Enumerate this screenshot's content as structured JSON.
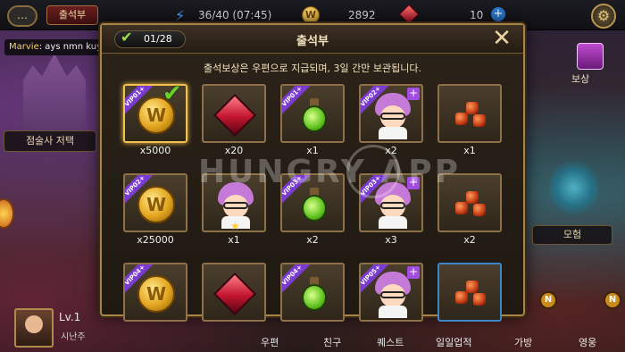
{
  "topbar": {
    "chat_icon": "…",
    "tab_label": "출석부",
    "stamina": "36/40 (07:45)",
    "gold_icon_letter": "W",
    "gold": "2892",
    "gems": "10",
    "add_symbol": "+",
    "settings_icon": "gear-icon"
  },
  "chat": {
    "name": "Marvie",
    "message": ": ays nmn kuya roy...umayos k h.."
  },
  "left": {
    "fortune_shop": "점술사 저택",
    "level": "Lv.1",
    "job": "시난주"
  },
  "right": {
    "reward": "보상",
    "adventure": "모험",
    "badge_letter": "N"
  },
  "bottom_nav": [
    "우편",
    "친구",
    "퀘스트",
    "일일업적",
    "가방",
    "영웅"
  ],
  "modal": {
    "title": "출석부",
    "counter": "01/28",
    "subtitle": "출석보상은 우편으로 지급되며, 3일 간만 보관됩니다.",
    "close_symbol": "✕",
    "rewards": [
      {
        "item": "gold",
        "qty": "x5000",
        "vip": "VIP01+",
        "claimed": true
      },
      {
        "item": "ruby",
        "qty": "x20",
        "vip": "",
        "claimed": false
      },
      {
        "item": "potion",
        "qty": "x1",
        "vip": "VIP01+",
        "claimed": false
      },
      {
        "item": "character",
        "qty": "x2",
        "vip": "VIP02+",
        "claimed": false
      },
      {
        "item": "ore",
        "qty": "x1",
        "vip": "",
        "claimed": false
      },
      {
        "item": "gold",
        "qty": "x25000",
        "vip": "VIP02+",
        "claimed": false
      },
      {
        "item": "character-star",
        "qty": "x1",
        "vip": "",
        "claimed": false
      },
      {
        "item": "potion",
        "qty": "x2",
        "vip": "VIP03+",
        "claimed": false
      },
      {
        "item": "character",
        "qty": "x3",
        "vip": "VIP03+",
        "claimed": false
      },
      {
        "item": "ore",
        "qty": "x2",
        "vip": "",
        "claimed": false
      },
      {
        "item": "gold",
        "qty": "",
        "vip": "VIP04+",
        "claimed": false
      },
      {
        "item": "ruby",
        "qty": "",
        "vip": "",
        "claimed": false
      },
      {
        "item": "potion",
        "qty": "",
        "vip": "VIP04+",
        "claimed": false
      },
      {
        "item": "character",
        "qty": "",
        "vip": "VIP05+",
        "claimed": false
      },
      {
        "item": "ore",
        "qty": "",
        "vip": "",
        "claimed": false
      }
    ]
  },
  "watermark": "HUNGRY APP"
}
